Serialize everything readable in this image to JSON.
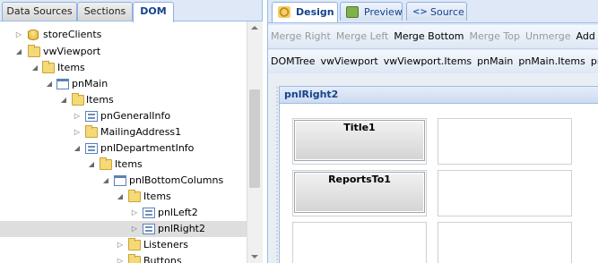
{
  "left_tabs": [
    {
      "label": "Data Sources",
      "active": false
    },
    {
      "label": "Sections",
      "active": false
    },
    {
      "label": "DOM",
      "active": true
    }
  ],
  "tree": [
    {
      "label": "storeClients",
      "icon": "database-icon",
      "expanded": false,
      "selected": false
    },
    {
      "label": "vwViewport",
      "icon": "folder-icon",
      "expanded": true,
      "selected": false
    },
    {
      "label": "Items",
      "icon": "folder-icon",
      "expanded": true,
      "selected": false
    },
    {
      "label": "pnMain",
      "icon": "panel-icon",
      "expanded": true,
      "selected": false
    },
    {
      "label": "Items",
      "icon": "folder-icon",
      "expanded": true,
      "selected": false
    },
    {
      "label": "pnGeneralInfo",
      "icon": "form-panel-icon",
      "expanded": false,
      "selected": false
    },
    {
      "label": "MailingAddress1",
      "icon": "folder-icon",
      "expanded": false,
      "selected": false
    },
    {
      "label": "pnlDepartmentInfo",
      "icon": "form-panel-icon",
      "expanded": true,
      "selected": false
    },
    {
      "label": "Items",
      "icon": "folder-icon",
      "expanded": true,
      "selected": false
    },
    {
      "label": "pnlBottomColumns",
      "icon": "panel-icon",
      "expanded": true,
      "selected": false
    },
    {
      "label": "Items",
      "icon": "folder-icon",
      "expanded": true,
      "selected": false
    },
    {
      "label": "pnlLeft2",
      "icon": "form-panel-icon",
      "expanded": false,
      "selected": false
    },
    {
      "label": "pnlRight2",
      "icon": "form-panel-icon",
      "expanded": false,
      "selected": true
    },
    {
      "label": "Listeners",
      "icon": "folder-icon",
      "expanded": false,
      "selected": false
    },
    {
      "label": "Buttons",
      "icon": "folder-icon",
      "expanded": false,
      "selected": false
    }
  ],
  "right_tabs": [
    {
      "label": "Design",
      "icon": "design-icon",
      "active": true
    },
    {
      "label": "Preview",
      "icon": "preview-icon",
      "active": false
    },
    {
      "label": "Source",
      "icon": "source-icon",
      "active": false
    }
  ],
  "toolbar": {
    "merge_right": "Merge Right",
    "merge_left": "Merge Left",
    "merge_bottom": "Merge Bottom",
    "merge_top": "Merge Top",
    "unmerge": "Unmerge",
    "add_row": "Add row below"
  },
  "breadcrumb": [
    "DOMTree",
    "vwViewport",
    "vwViewport.Items",
    "pnMain",
    "pnMain.Items",
    "pnlDepartmentInfo"
  ],
  "design_panel": {
    "title": "pnlRight2",
    "fields": [
      "Title1",
      "ReportsTo1"
    ]
  },
  "colors": {
    "accent": "#15428b",
    "selection": "#dedede",
    "border": "#99bbe8"
  }
}
